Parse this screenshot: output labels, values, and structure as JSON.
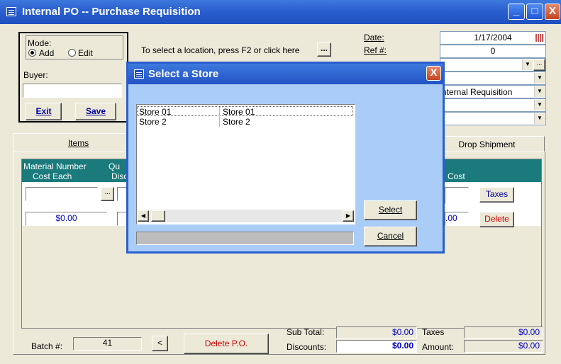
{
  "window": {
    "title": "Internal PO -- Purchase Requisition",
    "min_label": "_",
    "max_label": "□",
    "close_label": "X"
  },
  "mode": {
    "label": "Mode:",
    "add_label": "Add",
    "edit_label": "Edit",
    "selected": "Add"
  },
  "buyer": {
    "label": "Buyer:",
    "value": ""
  },
  "buttons": {
    "exit": "Exit",
    "save": "Save",
    "ellipsis": "...",
    "taxes": "Taxes",
    "delete": "Delete",
    "delete_po": "Delete P.O.",
    "prev": "<"
  },
  "location_hint": "To select a location, press F2 or click here",
  "date": {
    "label": "Date:",
    "value": "1/17/2004"
  },
  "ref": {
    "label": "Ref #:",
    "value": "0"
  },
  "dropdowns": [
    {
      "value": ""
    },
    {
      "value": ""
    },
    {
      "value": "nternal Requisition"
    },
    {
      "value": ""
    },
    {
      "value": ""
    }
  ],
  "tabs": {
    "items": "Items",
    "drop_shipment": "Drop Shipment"
  },
  "grid": {
    "col_material": "Material Number",
    "col_cost_each": "Cost Each",
    "col_qty": "Qu",
    "col_disc": "Disc",
    "col_cost": "Cost",
    "cost_each_value": "$0.00",
    "cost_value": ".00"
  },
  "footer": {
    "batch_label": "Batch #:",
    "batch_value": "41",
    "subtotal_label": "Sub Total:",
    "subtotal_value": "$0.00",
    "discounts_label": "Discounts:",
    "discounts_value": "$0.00",
    "taxes_label": "Taxes",
    "taxes_value": "$0.00",
    "amount_label": "Amount:",
    "amount_value": "$0.00"
  },
  "dialog": {
    "title": "Select a Store",
    "close_label": "X",
    "rows": [
      {
        "code": "Store 01",
        "name": "Store 01"
      },
      {
        "code": "Store 2",
        "name": "Store 2"
      }
    ],
    "select_label": "Select",
    "cancel_label": "Cancel"
  },
  "colors": {
    "titlebar": "#2a5fcf",
    "dialog_bg": "#a9cdf7",
    "grid_header": "#1a7a7c",
    "money": "#0000cc",
    "delete_text": "#cc0000"
  }
}
